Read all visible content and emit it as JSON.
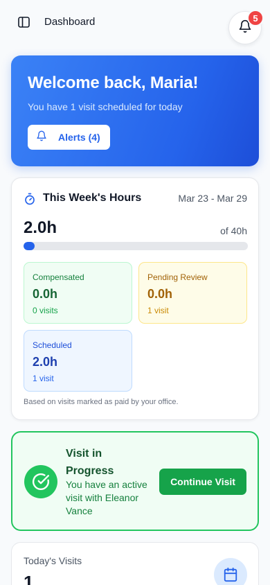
{
  "header": {
    "title": "Dashboard",
    "notification_count": "5",
    "sidebar_icon": "sidebar-toggle-icon",
    "bell_icon": "bell-icon"
  },
  "welcome": {
    "heading": "Welcome back, Maria!",
    "subtitle": "You have 1 visit scheduled for today",
    "alerts_label": "Alerts (4)"
  },
  "hours": {
    "title": "This Week's Hours",
    "date_range": "Mar 23 - Mar 29",
    "total": "2.0h",
    "target": "of 40h",
    "progress_fraction": 0.05,
    "stats": {
      "compensated": {
        "label": "Compensated",
        "value": "0.0h",
        "sub": "0 visits"
      },
      "pending": {
        "label": "Pending Review",
        "value": "0.0h",
        "sub": "1 visit"
      },
      "scheduled": {
        "label": "Scheduled",
        "value": "2.0h",
        "sub": "1 visit"
      }
    },
    "note": "Based on visits marked as paid by your office."
  },
  "visit_in_progress": {
    "title": "Visit in Progress",
    "description": "You have an active visit with Eleanor Vance",
    "button_label": "Continue Visit"
  },
  "today": {
    "label": "Today's Visits",
    "count": "1"
  },
  "colors": {
    "primary": "#2563eb",
    "success": "#22c55e",
    "danger": "#ef4444",
    "warning": "#a16207"
  }
}
